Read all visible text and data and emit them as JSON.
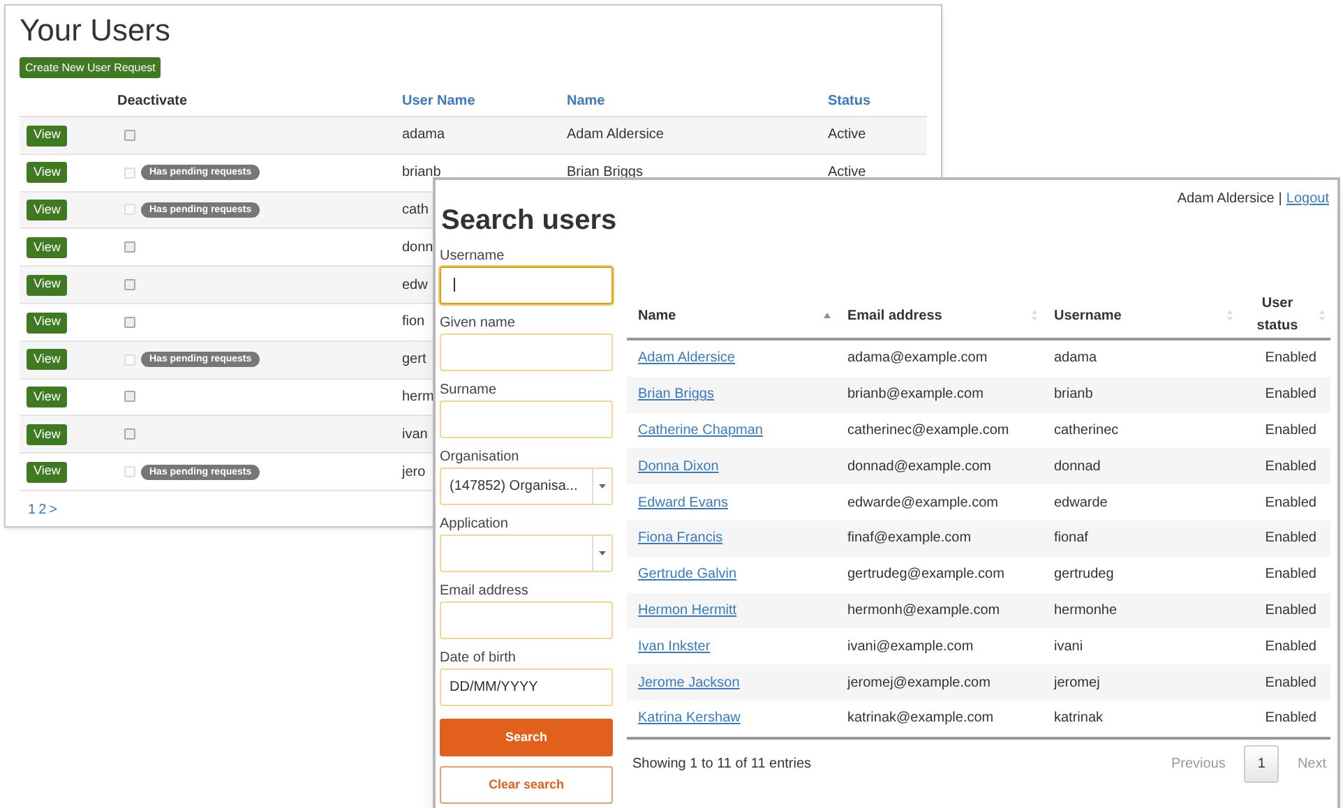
{
  "your_users": {
    "title": "Your Users",
    "create_button": "Create New User Request",
    "columns": [
      "Deactivate",
      "User Name",
      "Name",
      "Status"
    ],
    "rows": [
      {
        "view": "View",
        "checked": false,
        "disabled": false,
        "user_name": "adama",
        "name": "Adam Aldersice",
        "status": "Active"
      },
      {
        "view": "View",
        "checked": false,
        "disabled": true,
        "badge": "Has pending requests",
        "user_name": "brianb",
        "name": "Brian Briggs",
        "status": "Active"
      },
      {
        "view": "View",
        "checked": false,
        "disabled": true,
        "badge": "Has pending requests",
        "user_name": "cath"
      },
      {
        "view": "View",
        "checked": false,
        "disabled": false,
        "user_name": "donn"
      },
      {
        "view": "View",
        "checked": false,
        "disabled": false,
        "user_name": "edw"
      },
      {
        "view": "View",
        "checked": false,
        "disabled": false,
        "user_name": "fion"
      },
      {
        "view": "View",
        "checked": false,
        "disabled": true,
        "badge": "Has pending requests",
        "user_name": "gert"
      },
      {
        "view": "View",
        "checked": false,
        "disabled": false,
        "user_name": "herm"
      },
      {
        "view": "View",
        "checked": false,
        "disabled": false,
        "user_name": "ivan"
      },
      {
        "view": "View",
        "checked": false,
        "disabled": true,
        "badge": "Has pending requests",
        "user_name": "jero"
      }
    ],
    "pagination": [
      "1",
      "2",
      ">"
    ]
  },
  "search_users": {
    "title": "Search users",
    "user": "Adam Aldersice",
    "separator": "|",
    "logout": "Logout",
    "fields": [
      {
        "kind": "text",
        "label": "Username",
        "focused": true
      },
      {
        "kind": "text",
        "label": "Given name",
        "focused": false
      },
      {
        "kind": "text",
        "label": "Surname",
        "focused": false
      },
      {
        "kind": "select",
        "label": "Organisation",
        "value": "(147852) Organisa...",
        "focused": false
      },
      {
        "kind": "select",
        "label": "Application",
        "focused": false
      },
      {
        "kind": "text",
        "label": "Email address",
        "focused": false
      },
      {
        "kind": "text",
        "label": "Date of birth",
        "placeholder": "DD/MM/YYYY",
        "focused": false
      }
    ],
    "search_button": "Search",
    "clear_button": "Clear search",
    "columns": [
      {
        "label": "Name",
        "sorted": true
      },
      {
        "label": "Email address",
        "sorted": false
      },
      {
        "label": "Username",
        "sorted": false
      },
      {
        "label": "User status",
        "sorted": false
      }
    ],
    "rows": [
      [
        "Adam Aldersice",
        "adama@example.com",
        "adama",
        "Enabled"
      ],
      [
        "Brian Briggs",
        "brianb@example.com",
        "brianb",
        "Enabled"
      ],
      [
        "Catherine Chapman",
        "catherinec@example.com",
        "catherinec",
        "Enabled"
      ],
      [
        "Donna Dixon",
        "donnad@example.com",
        "donnad",
        "Enabled"
      ],
      [
        "Edward Evans",
        "edwarde@example.com",
        "edwarde",
        "Enabled"
      ],
      [
        "Fiona Francis",
        "finaf@example.com",
        "fionaf",
        "Enabled"
      ],
      [
        "Gertrude Galvin",
        "gertrudeg@example.com",
        "gertrudeg",
        "Enabled"
      ],
      [
        "Hermon Hermitt",
        "hermonh@example.com",
        "hermonhe",
        "Enabled"
      ],
      [
        "Ivan Inkster",
        "ivani@example.com",
        "ivani",
        "Enabled"
      ],
      [
        "Jerome Jackson",
        "jeromej@example.com",
        "jeromej",
        "Enabled"
      ],
      [
        "Katrina Kershaw",
        "katrinak@example.com",
        "katrinak",
        "Enabled"
      ]
    ],
    "summary": "Showing 1 to 11 of 11 entries",
    "pages": [
      {
        "label": "Previous",
        "kind": "prev"
      },
      {
        "label": "1",
        "kind": "page",
        "selected": true
      },
      {
        "label": "Next",
        "kind": "next"
      }
    ]
  }
}
